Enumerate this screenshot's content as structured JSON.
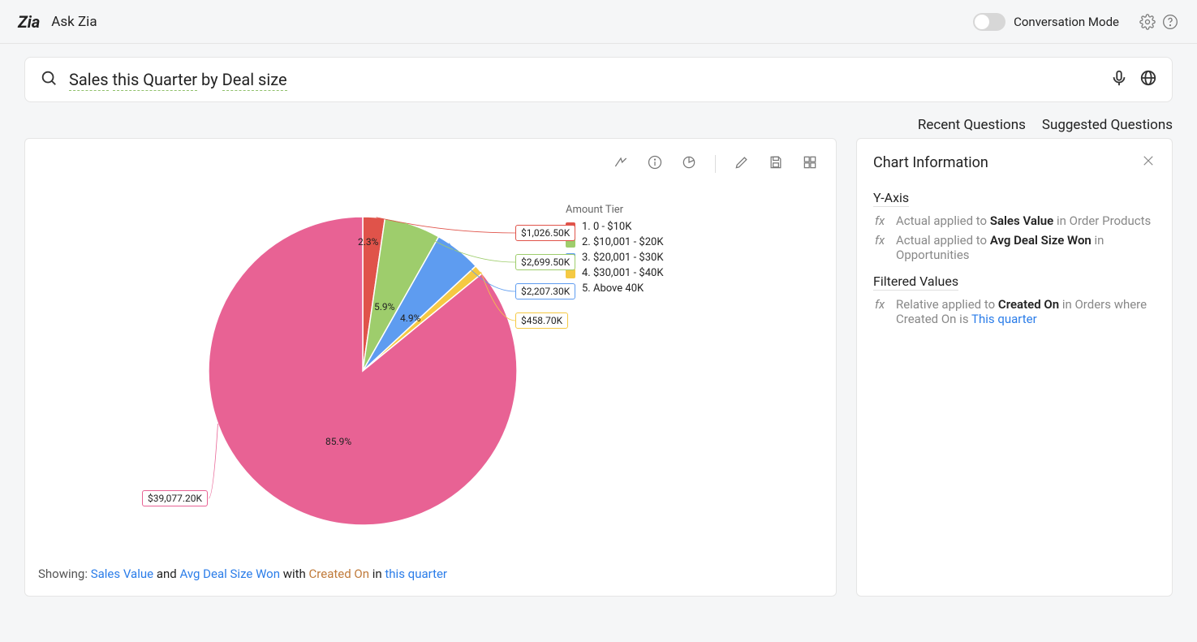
{
  "header": {
    "title": "Ask Zia",
    "mode_label": "Conversation Mode"
  },
  "search": {
    "tokens": [
      "Sales",
      "this Quarter",
      "by",
      "Deal size"
    ],
    "underline": [
      true,
      true,
      false,
      true
    ]
  },
  "links": {
    "recent": "Recent Questions",
    "suggested": "Suggested Questions"
  },
  "legend": {
    "title": "Amount Tier",
    "items": [
      {
        "label": "1. 0 - $10K",
        "color": "#e0534a"
      },
      {
        "label": "2. $10,001 - $20K",
        "color": "#9ecd6c"
      },
      {
        "label": "3. $20,001 - $30K",
        "color": "#5e9cf0"
      },
      {
        "label": "4. $30,001 - $40K",
        "color": "#f5c943"
      },
      {
        "label": "5. Above 40K",
        "color": "#e86294"
      }
    ]
  },
  "chart_data": {
    "type": "pie",
    "title": "",
    "series": [
      {
        "name": "1. 0 - $10K",
        "value": 1026.5,
        "label": "$1,026.50K",
        "percent": 2.3,
        "color": "#e0534a"
      },
      {
        "name": "2. $10,001 - $20K",
        "value": 2699.5,
        "label": "$2,699.50K",
        "percent": 5.9,
        "color": "#9ecd6c"
      },
      {
        "name": "3. $20,001 - $30K",
        "value": 2207.3,
        "label": "$2,207.30K",
        "percent": 4.9,
        "color": "#5e9cf0"
      },
      {
        "name": "4. $30,001 - $40K",
        "value": 458.7,
        "label": "$458.70K",
        "percent": 1.0,
        "color": "#f5c943"
      },
      {
        "name": "5. Above 40K",
        "value": 39077.2,
        "label": "$39,077.20K",
        "percent": 85.9,
        "color": "#e86294"
      }
    ]
  },
  "callouts": {
    "c0": "$1,026.50K",
    "c1": "$2,699.50K",
    "c2": "$2,207.30K",
    "c3": "$458.70K",
    "c4": "$39,077.20K",
    "p0": "2.3%",
    "p1": "5.9%",
    "p2": "4.9%",
    "p3": "85.9%"
  },
  "showing": {
    "prefix": "Showing:",
    "sales": "Sales Value",
    "and": " and ",
    "avg": "Avg Deal Size Won",
    "with": " with ",
    "created": "Created On",
    "in": " in ",
    "quarter": "this quarter"
  },
  "info": {
    "title": "Chart Information",
    "yaxis": "Y-Axis",
    "r1_a": "Actual ",
    "r1_b": "applied to ",
    "r1_c": "Sales Value",
    "r1_d": " in Order Products",
    "r2_a": "Actual ",
    "r2_b": "applied to ",
    "r2_c": "Avg Deal Size Won",
    "r2_d": " in Opportunities",
    "filtered": "Filtered Values",
    "r3_a": "Relative ",
    "r3_b": "applied to ",
    "r3_c": "Created On",
    "r3_d": " in Orders where Created On is ",
    "r3_e": "This quarter"
  }
}
